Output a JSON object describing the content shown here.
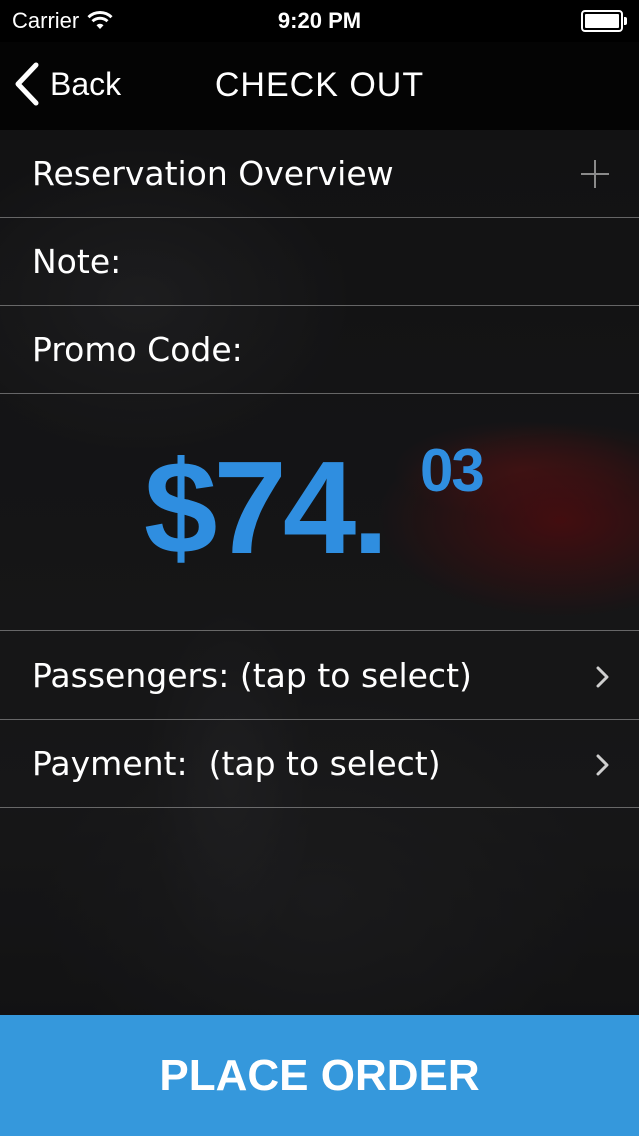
{
  "status_bar": {
    "carrier": "Carrier",
    "time": "9:20 PM",
    "icons": [
      "wifi-icon",
      "battery-icon"
    ]
  },
  "nav": {
    "back_label": "Back",
    "title": "CHECK OUT"
  },
  "rows": {
    "reservation_overview": "Reservation Overview",
    "note": "Note:",
    "promo_code": "Promo Code:",
    "passengers": "Passengers: (tap to select)",
    "payment": "Payment:  (tap to select)"
  },
  "price": {
    "dollars": "$74.",
    "cents": "03"
  },
  "actions": {
    "place_order": "PLACE ORDER"
  },
  "colors": {
    "accent": "#3598dc",
    "price_text": "#2f8ee0"
  }
}
